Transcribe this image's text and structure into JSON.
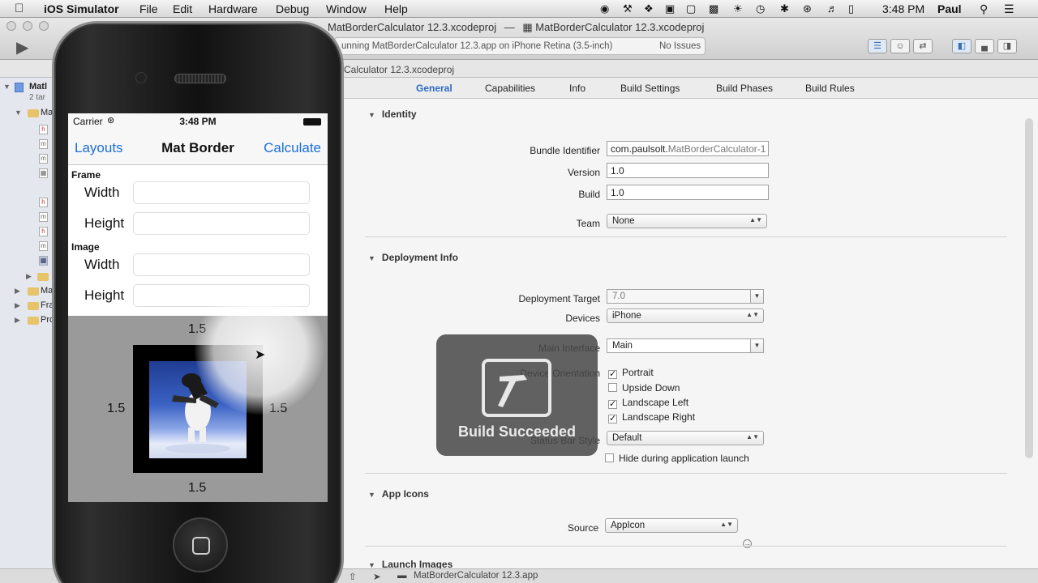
{
  "menubar": {
    "app_name": "iOS Simulator",
    "items": [
      "File",
      "Edit",
      "Hardware",
      "Debug",
      "Window",
      "Help"
    ],
    "time": "3:48 PM",
    "user": "Paul"
  },
  "window": {
    "title_left": "MatBorderCalculator 12.3.xcodeproj",
    "title_right": "MatBorderCalculator 12.3.xcodeproj",
    "status_text": "unning MatBorderCalculator 12.3.app on iPhone Retina (3.5-inch)",
    "status_issues": "No Issues",
    "path_crumb": "Calculator 12.3.xcodeproj"
  },
  "navigator": {
    "rows": [
      {
        "label": "Matl"
      },
      {
        "label": "2 tar"
      },
      {
        "label": "Ma"
      },
      {
        "label": "Ma"
      },
      {
        "label": "Fra"
      },
      {
        "label": "Pro"
      }
    ]
  },
  "editor": {
    "tabs": [
      {
        "label": "General",
        "selected": true
      },
      {
        "label": "Capabilities"
      },
      {
        "label": "Info"
      },
      {
        "label": "Build Settings"
      },
      {
        "label": "Build Phases"
      },
      {
        "label": "Build Rules"
      }
    ],
    "identity": {
      "header": "Identity",
      "bundle_identifier_label": "Bundle Identifier",
      "bundle_identifier_prefix": "com.paulsolt.",
      "bundle_identifier_suffix": "MatBorderCalculator-1",
      "version_label": "Version",
      "version": "1.0",
      "build_label": "Build",
      "build": "1.0",
      "team_label": "Team",
      "team": "None"
    },
    "deployment": {
      "header": "Deployment Info",
      "target_label": "Deployment Target",
      "target": "7.0",
      "devices_label": "Devices",
      "devices": "iPhone",
      "main_interface_label": "Main Interface",
      "main_interface": "Main",
      "orientation_label": "Device Orientation",
      "orientations": [
        {
          "label": "Portrait",
          "checked": true
        },
        {
          "label": "Upside Down",
          "checked": false
        },
        {
          "label": "Landscape Left",
          "checked": true
        },
        {
          "label": "Landscape Right",
          "checked": true
        }
      ],
      "status_bar_label": "Status Bar Style",
      "status_bar": "Default",
      "hide_status_bar": "Hide during application launch"
    },
    "app_icons": {
      "header": "App Icons",
      "source_label": "Source",
      "source": "AppIcon"
    },
    "launch_images": {
      "header": "Launch Images"
    }
  },
  "bottombar": {
    "scheme": "MatBorderCalculator 12.3.app"
  },
  "hud": {
    "message": "Build Succeeded"
  },
  "simulator": {
    "carrier": "Carrier",
    "time": "3:48 PM",
    "nav_left": "Layouts",
    "nav_title": "Mat Border",
    "nav_right": "Calculate",
    "frame_section": "Frame",
    "image_section": "Image",
    "width_label": "Width",
    "height_label": "Height",
    "mat_top": "1.5",
    "mat_left": "1.5",
    "mat_right": "1.5",
    "mat_bottom": "1.5"
  },
  "colors": {
    "accent": "#2a6ac2",
    "ios_blue": "#1b6fd8",
    "hud": "#484848"
  }
}
